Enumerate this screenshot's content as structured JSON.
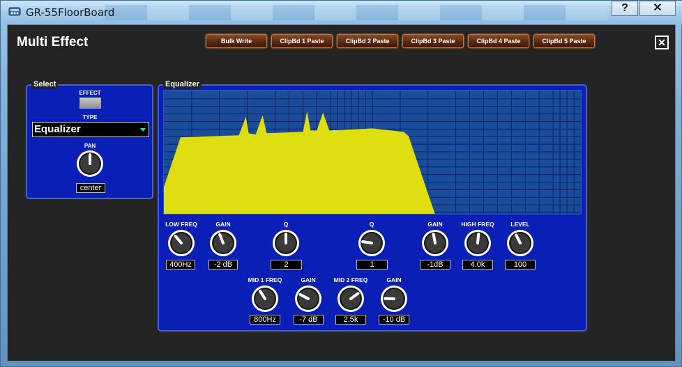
{
  "window": {
    "title": "GR-55FloorBoard",
    "help_label": "?",
    "close_label": "✕"
  },
  "panel": {
    "title": "Multi Effect",
    "close_label": "✕"
  },
  "clipboard_buttons": [
    {
      "label": "Bulk Write"
    },
    {
      "label": "ClipBd 1 Paste"
    },
    {
      "label": "ClipBd 2 Paste"
    },
    {
      "label": "ClipBd 3 Paste"
    },
    {
      "label": "ClipBd 4 Paste"
    },
    {
      "label": "ClipBd 5 Paste"
    }
  ],
  "select_group": {
    "title": "Select",
    "effect_label": "EFFECT",
    "type_label": "TYPE",
    "type_value": "Equalizer",
    "pan_label": "PAN",
    "pan_value": "center",
    "pan_level": 0.5
  },
  "equalizer_group": {
    "title": "Equalizer",
    "knobs_row1": [
      {
        "label": "LOW FREQ",
        "value": "400Hz",
        "level": 0.35
      },
      {
        "label": "GAIN",
        "value": "-2 dB",
        "level": 0.42
      },
      {
        "label": "Q",
        "value": "2",
        "level": 0.5
      },
      {
        "label": "Q",
        "value": "1",
        "level": 0.2
      },
      {
        "label": "GAIN",
        "value": "-1dB",
        "level": 0.46
      },
      {
        "label": "HIGH FREQ",
        "value": "4.0k",
        "level": 0.52
      },
      {
        "label": "LEVEL",
        "value": "100",
        "level": 0.4
      }
    ],
    "knobs_row2": [
      {
        "label": "MID 1 FREQ",
        "value": "800Hz",
        "level": 0.38
      },
      {
        "label": "GAIN",
        "value": "-7 dB",
        "level": 0.27
      },
      {
        "label": "MID 2 FREQ",
        "value": "2.5k",
        "level": 0.7
      },
      {
        "label": "GAIN",
        "value": "-10 dB",
        "level": 0.17
      }
    ]
  },
  "colors": {
    "panel_bg": "#242424",
    "group_bg": "#0a1fb6",
    "eq_curve": "#dede10",
    "clip_button": "#5b2a10"
  }
}
